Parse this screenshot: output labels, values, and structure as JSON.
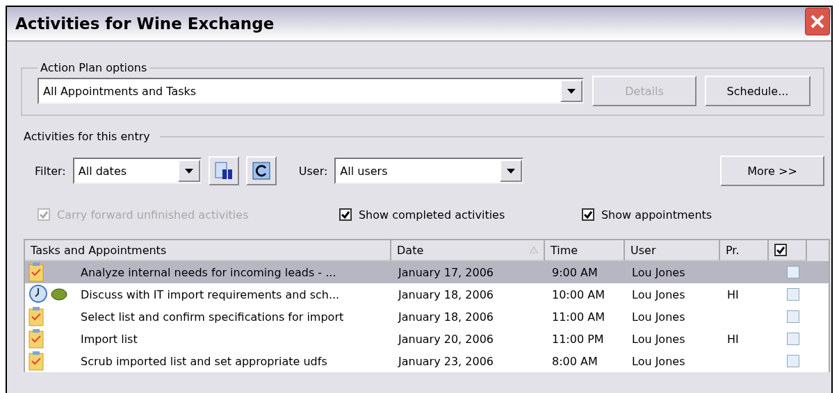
{
  "window": {
    "title": "Activities for Wine Exchange"
  },
  "action_plan": {
    "legend": "Action Plan options",
    "value": "All Appointments and Tasks",
    "buttons": [
      {
        "label": "Details",
        "disabled": true
      },
      {
        "label": "Schedule...",
        "disabled": false
      }
    ]
  },
  "activities": {
    "heading": "Activities for this entry",
    "filter_label": "Filter:",
    "filter_value": "All dates",
    "user_label": "User:",
    "user_value": "All users",
    "more_button": "More >>",
    "options": [
      {
        "label": "Carry forward unfinished activities",
        "checked": true,
        "disabled": true
      },
      {
        "label": "Show completed activities",
        "checked": true,
        "disabled": false
      },
      {
        "label": "Show appointments",
        "checked": true,
        "disabled": false
      }
    ]
  },
  "table": {
    "columns": [
      "Tasks and Appointments",
      "Date",
      "Time",
      "User",
      "Pr."
    ],
    "done_header_checked": true,
    "rows": [
      {
        "kind": "task",
        "linked": false,
        "title": "Analyze internal needs for incoming leads - ...",
        "date": "January 17, 2006",
        "time": "9:00 AM",
        "user": "Lou Jones",
        "priority": "",
        "done": false,
        "selected": true
      },
      {
        "kind": "appointment",
        "linked": true,
        "title": "Discuss with IT import requirements and sch...",
        "date": "January 18, 2006",
        "time": "10:00 AM",
        "user": "Lou Jones",
        "priority": "HI",
        "done": false,
        "selected": false
      },
      {
        "kind": "task",
        "linked": false,
        "title": "Select list and confirm specifications for import",
        "date": "January 18, 2006",
        "time": "11:00 AM",
        "user": "Lou Jones",
        "priority": "",
        "done": false,
        "selected": false
      },
      {
        "kind": "task",
        "linked": false,
        "title": "Import list",
        "date": "January 20, 2006",
        "time": "11:00 PM",
        "user": "Lou Jones",
        "priority": "HI",
        "done": false,
        "selected": false
      },
      {
        "kind": "task",
        "linked": false,
        "title": "Scrub imported list and set appropriate udfs",
        "date": "January 23, 2006",
        "time": "8:00 AM",
        "user": "Lou Jones",
        "priority": "",
        "done": false,
        "selected": false
      }
    ]
  }
}
